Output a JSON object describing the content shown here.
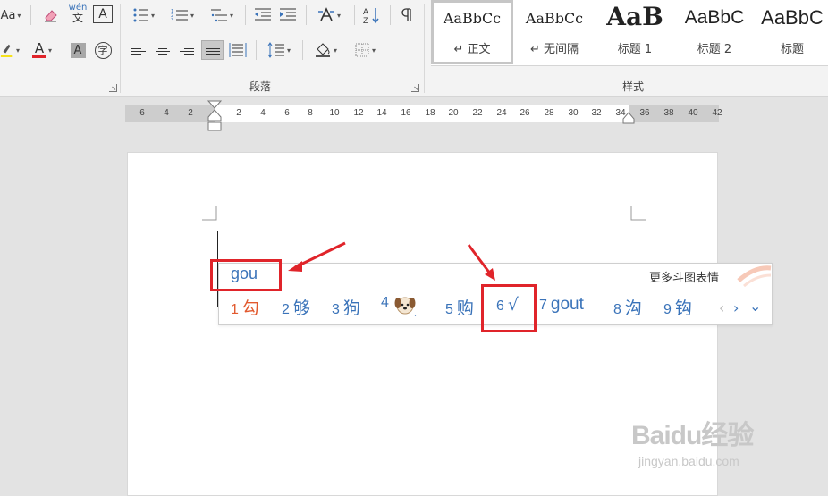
{
  "ribbon": {
    "font_group": {
      "change_case_label": "Aa",
      "phonetic_top": "wén",
      "phonetic_bottom": "文",
      "char_border_label": "A",
      "font_color_label": "A",
      "char_shading_label": "A",
      "enclose_char_label": "字"
    },
    "paragraph": {
      "label": "段落"
    },
    "styles": {
      "label": "样式",
      "items": [
        {
          "sample": "AaBbCc",
          "name": "↵ 正文",
          "selected": true
        },
        {
          "sample": "AaBbCc",
          "name": "↵ 无间隔",
          "selected": false
        },
        {
          "sample": "AaB",
          "name": "标题 1",
          "selected": false
        },
        {
          "sample": "AaBbC",
          "name": "标题 2",
          "selected": false
        },
        {
          "sample": "AaBbC",
          "name": "标题",
          "selected": false
        }
      ]
    }
  },
  "ruler": {
    "ticks": [
      "6",
      "4",
      "2",
      "2",
      "4",
      "6",
      "8",
      "10",
      "12",
      "14",
      "16",
      "18",
      "20",
      "22",
      "24",
      "26",
      "28",
      "30",
      "32",
      "34",
      "36",
      "38",
      "40",
      "42"
    ]
  },
  "ime": {
    "input": "gou",
    "more_label": "更多斗图表情",
    "candidates": [
      {
        "num": "1",
        "text": "勾"
      },
      {
        "num": "2",
        "text": "够"
      },
      {
        "num": "3",
        "text": "狗"
      },
      {
        "num": "4",
        "text": ""
      },
      {
        "num": "5",
        "text": "购"
      },
      {
        "num": "6",
        "text": "√"
      },
      {
        "num": "7",
        "text": "gout"
      },
      {
        "num": "8",
        "text": "沟"
      },
      {
        "num": "9",
        "text": "钩"
      }
    ],
    "prev": "‹",
    "next": "›",
    "expand": "⌄"
  },
  "watermark": {
    "main": "Baidu经验",
    "sub": "jingyan.baidu.com"
  },
  "colors": {
    "accent_red": "#e0242a",
    "ime_blue": "#3a73b9",
    "first_candidate": "#e25a2f"
  }
}
